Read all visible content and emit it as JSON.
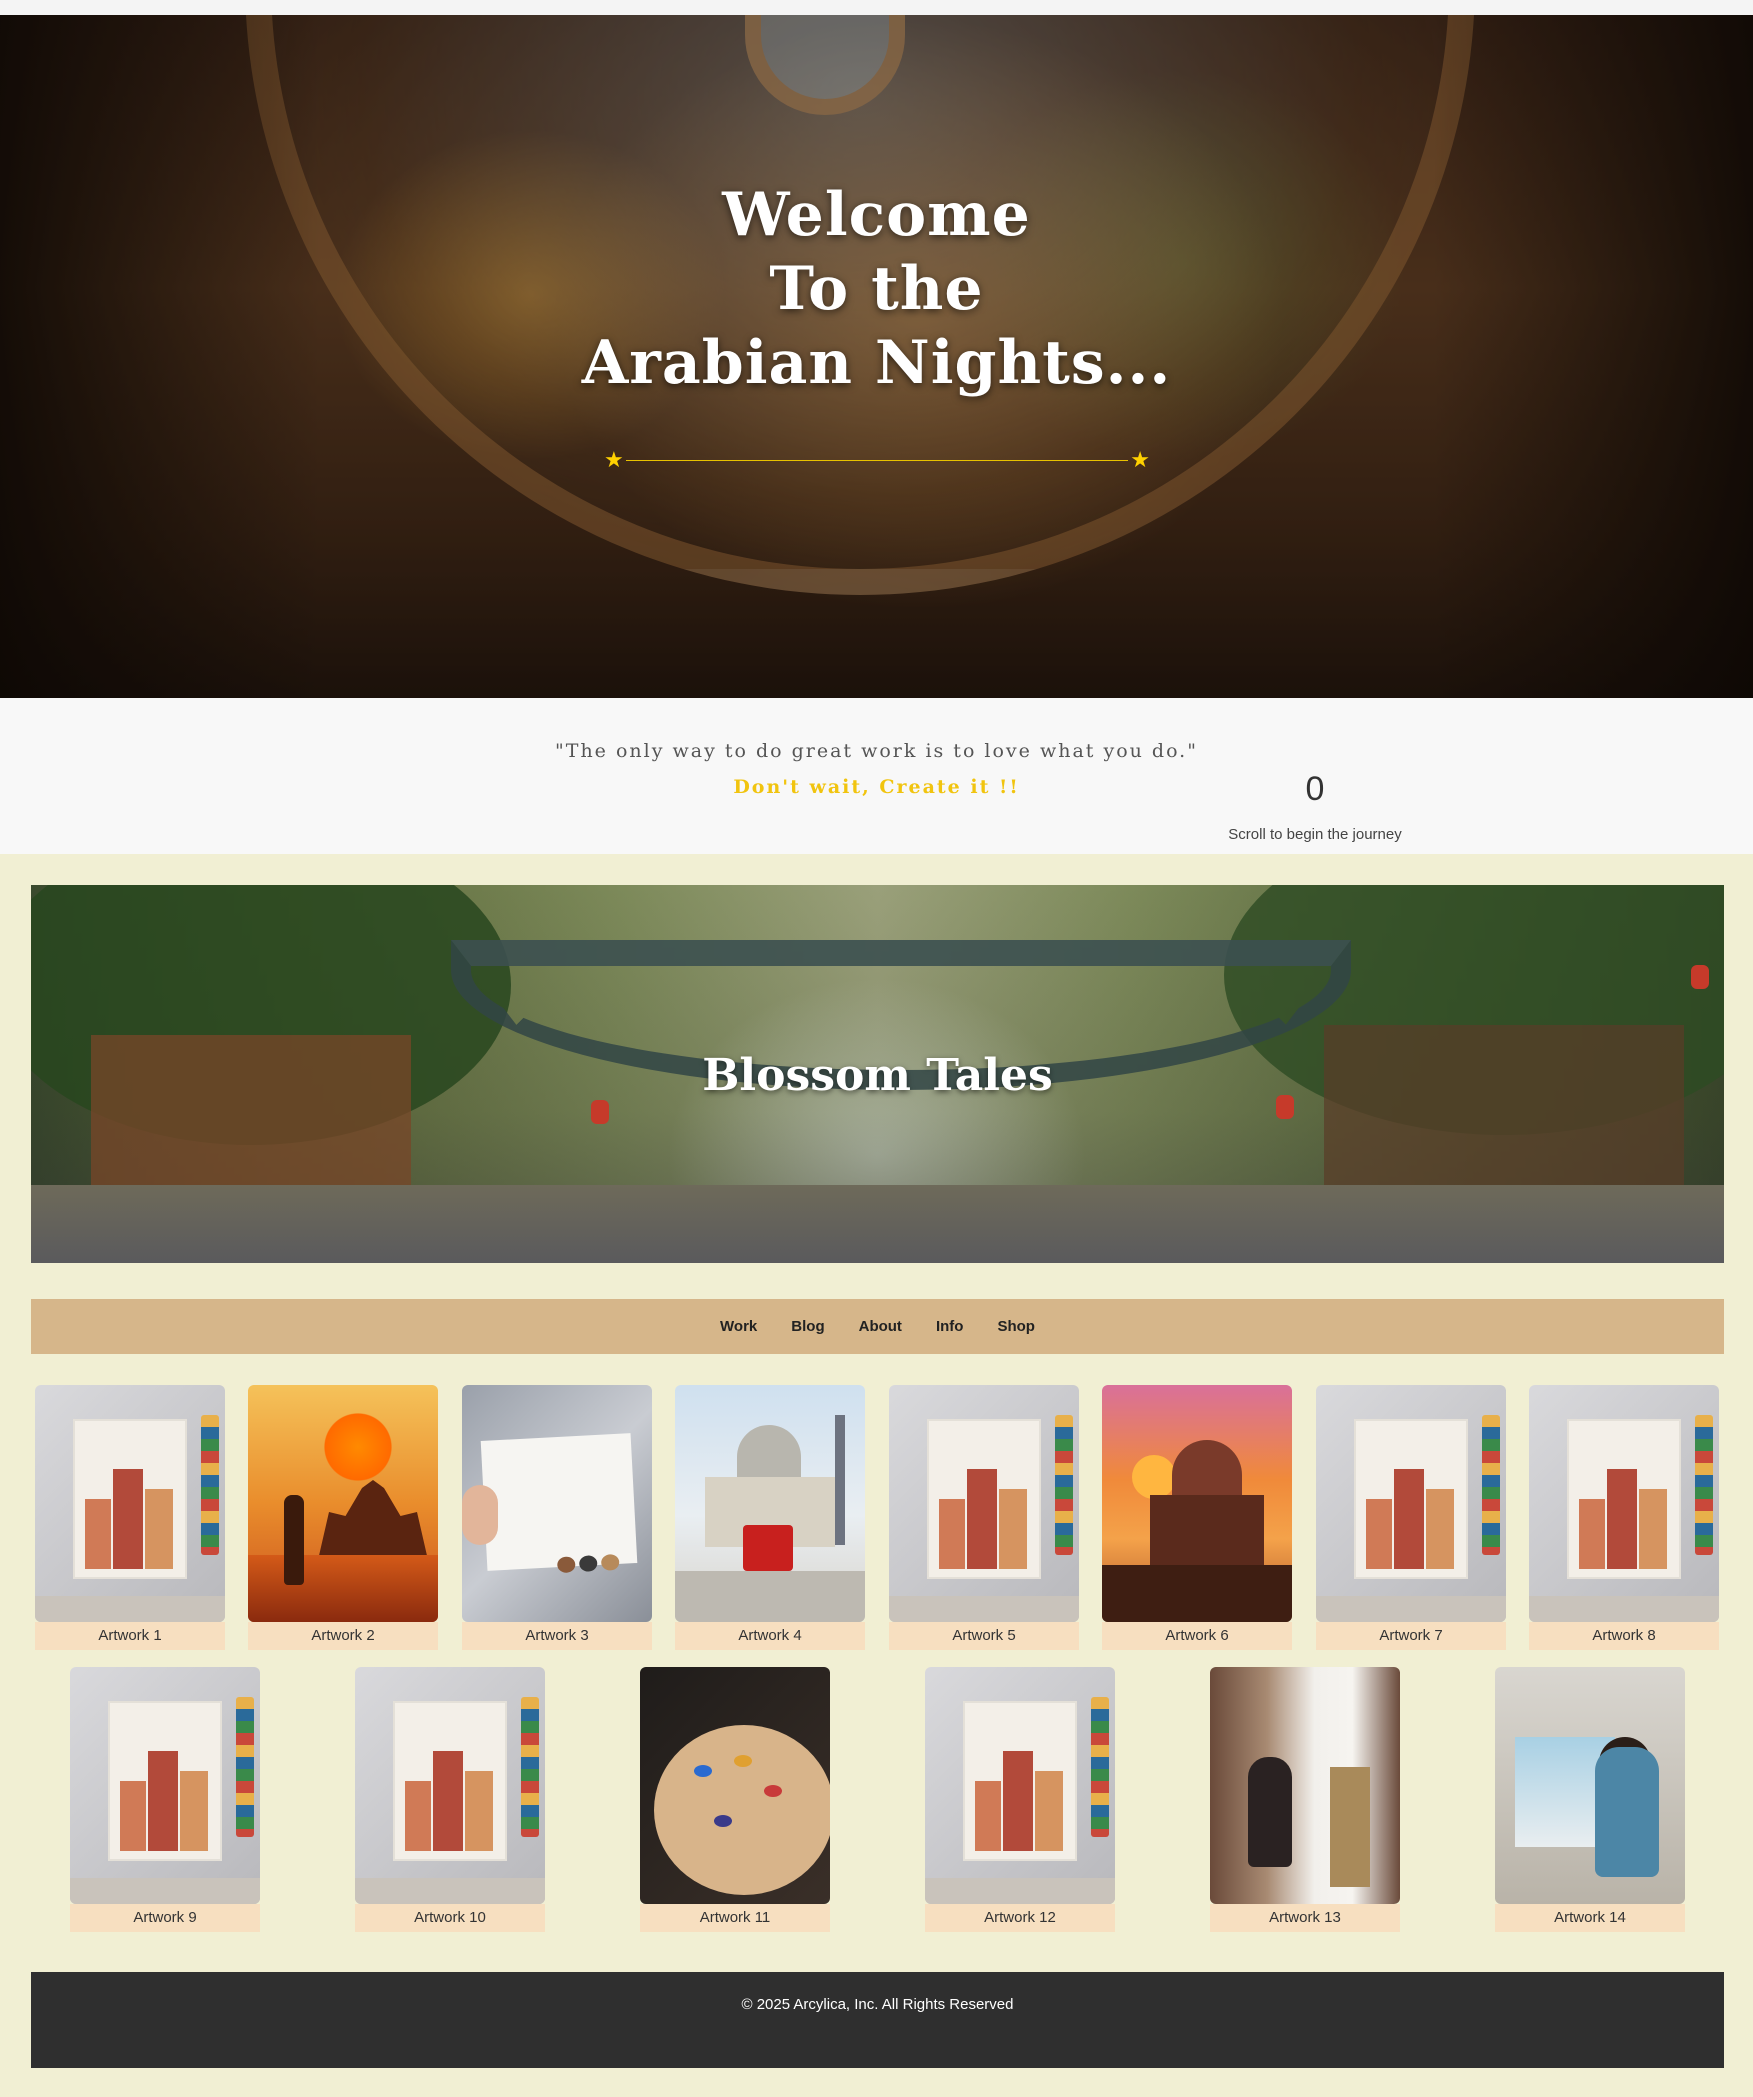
{
  "hero": {
    "title_line1": "Welcome",
    "title_line2": "To the",
    "title_line3": "Arabian Nights...",
    "divider_star_left": "★",
    "divider_star_right": "★"
  },
  "quote_section": {
    "quote": "\"The only way to do great work is to love what you do.\"",
    "cta": "Don't wait, Create it !!",
    "scroll_count": "0",
    "scroll_text": "Scroll to begin the journey"
  },
  "banner": {
    "title": "Blossom Tales"
  },
  "nav": {
    "items": [
      "Work",
      "Blog",
      "About",
      "Info",
      "Shop"
    ]
  },
  "gallery": {
    "items": [
      {
        "label": "Artwork 1"
      },
      {
        "label": "Artwork 2"
      },
      {
        "label": "Artwork 3"
      },
      {
        "label": "Artwork 4"
      },
      {
        "label": "Artwork 5"
      },
      {
        "label": "Artwork 6"
      },
      {
        "label": "Artwork 7"
      },
      {
        "label": "Artwork 8"
      },
      {
        "label": "Artwork 9"
      },
      {
        "label": "Artwork 10"
      },
      {
        "label": "Artwork 11"
      },
      {
        "label": "Artwork 12"
      },
      {
        "label": "Artwork 13"
      },
      {
        "label": "Artwork 14"
      }
    ]
  },
  "footer": {
    "copyright": "© 2025 Arcylica, Inc. All Rights Reserved"
  },
  "colors": {
    "page_background": "#f1efd3",
    "accent_gold": "#f1c40f",
    "nav_background": "#d6b68a",
    "caption_background": "#f7dfc0",
    "footer_background": "#2f2f2f"
  }
}
